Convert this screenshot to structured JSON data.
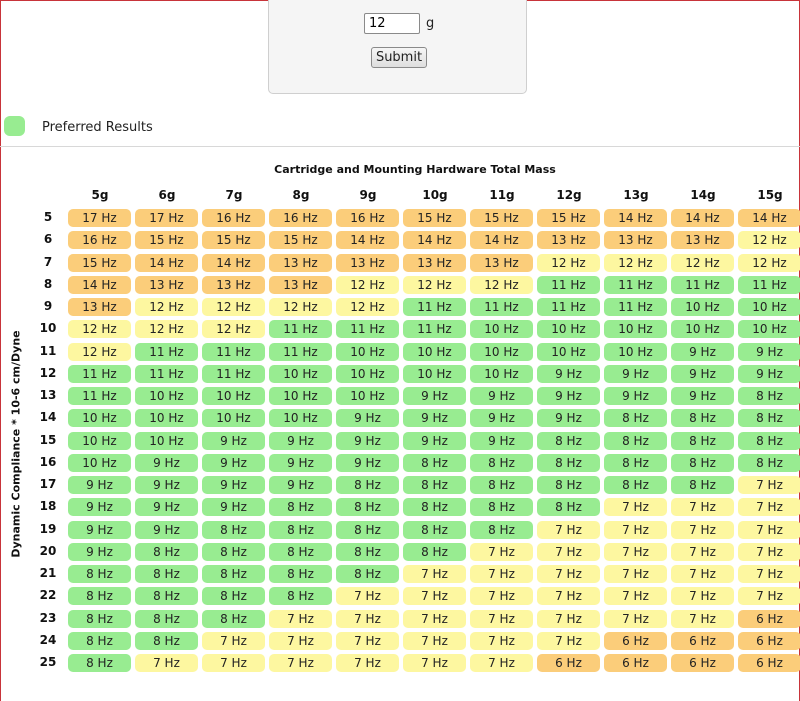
{
  "form": {
    "mass_value": "12",
    "unit": "g",
    "submit_label": "Submit"
  },
  "legend": {
    "label": "Preferred Results",
    "color": "#98ec91"
  },
  "table": {
    "title": "Cartridge and Mounting Hardware Total Mass",
    "y_label": "Dynamic Compliance * 10-6 cm/Dyne",
    "columns": [
      "5g",
      "6g",
      "7g",
      "8g",
      "9g",
      "10g",
      "11g",
      "12g",
      "13g",
      "14g",
      "15g"
    ],
    "rows": [
      "5",
      "6",
      "7",
      "8",
      "9",
      "10",
      "11",
      "12",
      "13",
      "14",
      "15",
      "16",
      "17",
      "18",
      "19",
      "20",
      "21",
      "22",
      "23",
      "24",
      "25"
    ],
    "cells": [
      [
        "17 Hz",
        "17 Hz",
        "16 Hz",
        "16 Hz",
        "16 Hz",
        "15 Hz",
        "15 Hz",
        "15 Hz",
        "14 Hz",
        "14 Hz",
        "14 Hz"
      ],
      [
        "16 Hz",
        "15 Hz",
        "15 Hz",
        "15 Hz",
        "14 Hz",
        "14 Hz",
        "14 Hz",
        "13 Hz",
        "13 Hz",
        "13 Hz",
        "12 Hz"
      ],
      [
        "15 Hz",
        "14 Hz",
        "14 Hz",
        "13 Hz",
        "13 Hz",
        "13 Hz",
        "13 Hz",
        "12 Hz",
        "12 Hz",
        "12 Hz",
        "12 Hz"
      ],
      [
        "14 Hz",
        "13 Hz",
        "13 Hz",
        "13 Hz",
        "12 Hz",
        "12 Hz",
        "12 Hz",
        "11 Hz",
        "11 Hz",
        "11 Hz",
        "11 Hz"
      ],
      [
        "13 Hz",
        "12 Hz",
        "12 Hz",
        "12 Hz",
        "12 Hz",
        "11 Hz",
        "11 Hz",
        "11 Hz",
        "11 Hz",
        "10 Hz",
        "10 Hz"
      ],
      [
        "12 Hz",
        "12 Hz",
        "12 Hz",
        "11 Hz",
        "11 Hz",
        "11 Hz",
        "10 Hz",
        "10 Hz",
        "10 Hz",
        "10 Hz",
        "10 Hz"
      ],
      [
        "12 Hz",
        "11 Hz",
        "11 Hz",
        "11 Hz",
        "10 Hz",
        "10 Hz",
        "10 Hz",
        "10 Hz",
        "10 Hz",
        "9 Hz",
        "9 Hz"
      ],
      [
        "11 Hz",
        "11 Hz",
        "11 Hz",
        "10 Hz",
        "10 Hz",
        "10 Hz",
        "10 Hz",
        "9 Hz",
        "9 Hz",
        "9 Hz",
        "9 Hz"
      ],
      [
        "11 Hz",
        "10 Hz",
        "10 Hz",
        "10 Hz",
        "10 Hz",
        "9 Hz",
        "9 Hz",
        "9 Hz",
        "9 Hz",
        "9 Hz",
        "8 Hz"
      ],
      [
        "10 Hz",
        "10 Hz",
        "10 Hz",
        "10 Hz",
        "9 Hz",
        "9 Hz",
        "9 Hz",
        "9 Hz",
        "8 Hz",
        "8 Hz",
        "8 Hz"
      ],
      [
        "10 Hz",
        "10 Hz",
        "9 Hz",
        "9 Hz",
        "9 Hz",
        "9 Hz",
        "9 Hz",
        "8 Hz",
        "8 Hz",
        "8 Hz",
        "8 Hz"
      ],
      [
        "10 Hz",
        "9 Hz",
        "9 Hz",
        "9 Hz",
        "9 Hz",
        "8 Hz",
        "8 Hz",
        "8 Hz",
        "8 Hz",
        "8 Hz",
        "8 Hz"
      ],
      [
        "9 Hz",
        "9 Hz",
        "9 Hz",
        "9 Hz",
        "8 Hz",
        "8 Hz",
        "8 Hz",
        "8 Hz",
        "8 Hz",
        "8 Hz",
        "7 Hz"
      ],
      [
        "9 Hz",
        "9 Hz",
        "9 Hz",
        "8 Hz",
        "8 Hz",
        "8 Hz",
        "8 Hz",
        "8 Hz",
        "7 Hz",
        "7 Hz",
        "7 Hz"
      ],
      [
        "9 Hz",
        "9 Hz",
        "8 Hz",
        "8 Hz",
        "8 Hz",
        "8 Hz",
        "8 Hz",
        "7 Hz",
        "7 Hz",
        "7 Hz",
        "7 Hz"
      ],
      [
        "9 Hz",
        "8 Hz",
        "8 Hz",
        "8 Hz",
        "8 Hz",
        "8 Hz",
        "7 Hz",
        "7 Hz",
        "7 Hz",
        "7 Hz",
        "7 Hz"
      ],
      [
        "8 Hz",
        "8 Hz",
        "8 Hz",
        "8 Hz",
        "8 Hz",
        "7 Hz",
        "7 Hz",
        "7 Hz",
        "7 Hz",
        "7 Hz",
        "7 Hz"
      ],
      [
        "8 Hz",
        "8 Hz",
        "8 Hz",
        "8 Hz",
        "7 Hz",
        "7 Hz",
        "7 Hz",
        "7 Hz",
        "7 Hz",
        "7 Hz",
        "7 Hz"
      ],
      [
        "8 Hz",
        "8 Hz",
        "8 Hz",
        "7 Hz",
        "7 Hz",
        "7 Hz",
        "7 Hz",
        "7 Hz",
        "7 Hz",
        "7 Hz",
        "6 Hz"
      ],
      [
        "8 Hz",
        "8 Hz",
        "7 Hz",
        "7 Hz",
        "7 Hz",
        "7 Hz",
        "7 Hz",
        "7 Hz",
        "6 Hz",
        "6 Hz",
        "6 Hz"
      ],
      [
        "8 Hz",
        "7 Hz",
        "7 Hz",
        "7 Hz",
        "7 Hz",
        "7 Hz",
        "7 Hz",
        "6 Hz",
        "6 Hz",
        "6 Hz",
        "6 Hz"
      ]
    ],
    "category_colors": {
      "preferred": "#98ec91",
      "marginal": "#fdf7a0",
      "outside": "#fbcd7a"
    },
    "categories": [
      [
        "o",
        "o",
        "o",
        "o",
        "o",
        "o",
        "o",
        "o",
        "o",
        "o",
        "o"
      ],
      [
        "o",
        "o",
        "o",
        "o",
        "o",
        "o",
        "o",
        "o",
        "o",
        "o",
        "y"
      ],
      [
        "o",
        "o",
        "o",
        "o",
        "o",
        "o",
        "o",
        "y",
        "y",
        "y",
        "y"
      ],
      [
        "o",
        "o",
        "o",
        "o",
        "y",
        "y",
        "y",
        "g",
        "g",
        "g",
        "g"
      ],
      [
        "o",
        "y",
        "y",
        "y",
        "y",
        "g",
        "g",
        "g",
        "g",
        "g",
        "g"
      ],
      [
        "y",
        "y",
        "y",
        "g",
        "g",
        "g",
        "g",
        "g",
        "g",
        "g",
        "g"
      ],
      [
        "y",
        "g",
        "g",
        "g",
        "g",
        "g",
        "g",
        "g",
        "g",
        "g",
        "g"
      ],
      [
        "g",
        "g",
        "g",
        "g",
        "g",
        "g",
        "g",
        "g",
        "g",
        "g",
        "g"
      ],
      [
        "g",
        "g",
        "g",
        "g",
        "g",
        "g",
        "g",
        "g",
        "g",
        "g",
        "g"
      ],
      [
        "g",
        "g",
        "g",
        "g",
        "g",
        "g",
        "g",
        "g",
        "g",
        "g",
        "g"
      ],
      [
        "g",
        "g",
        "g",
        "g",
        "g",
        "g",
        "g",
        "g",
        "g",
        "g",
        "g"
      ],
      [
        "g",
        "g",
        "g",
        "g",
        "g",
        "g",
        "g",
        "g",
        "g",
        "g",
        "g"
      ],
      [
        "g",
        "g",
        "g",
        "g",
        "g",
        "g",
        "g",
        "g",
        "g",
        "g",
        "y"
      ],
      [
        "g",
        "g",
        "g",
        "g",
        "g",
        "g",
        "g",
        "g",
        "y",
        "y",
        "y"
      ],
      [
        "g",
        "g",
        "g",
        "g",
        "g",
        "g",
        "g",
        "y",
        "y",
        "y",
        "y"
      ],
      [
        "g",
        "g",
        "g",
        "g",
        "g",
        "g",
        "y",
        "y",
        "y",
        "y",
        "y"
      ],
      [
        "g",
        "g",
        "g",
        "g",
        "g",
        "y",
        "y",
        "y",
        "y",
        "y",
        "y"
      ],
      [
        "g",
        "g",
        "g",
        "g",
        "y",
        "y",
        "y",
        "y",
        "y",
        "y",
        "y"
      ],
      [
        "g",
        "g",
        "g",
        "y",
        "y",
        "y",
        "y",
        "y",
        "y",
        "y",
        "o"
      ],
      [
        "g",
        "g",
        "y",
        "y",
        "y",
        "y",
        "y",
        "y",
        "o",
        "o",
        "o"
      ],
      [
        "g",
        "y",
        "y",
        "y",
        "y",
        "y",
        "y",
        "o",
        "o",
        "o",
        "o"
      ]
    ]
  }
}
